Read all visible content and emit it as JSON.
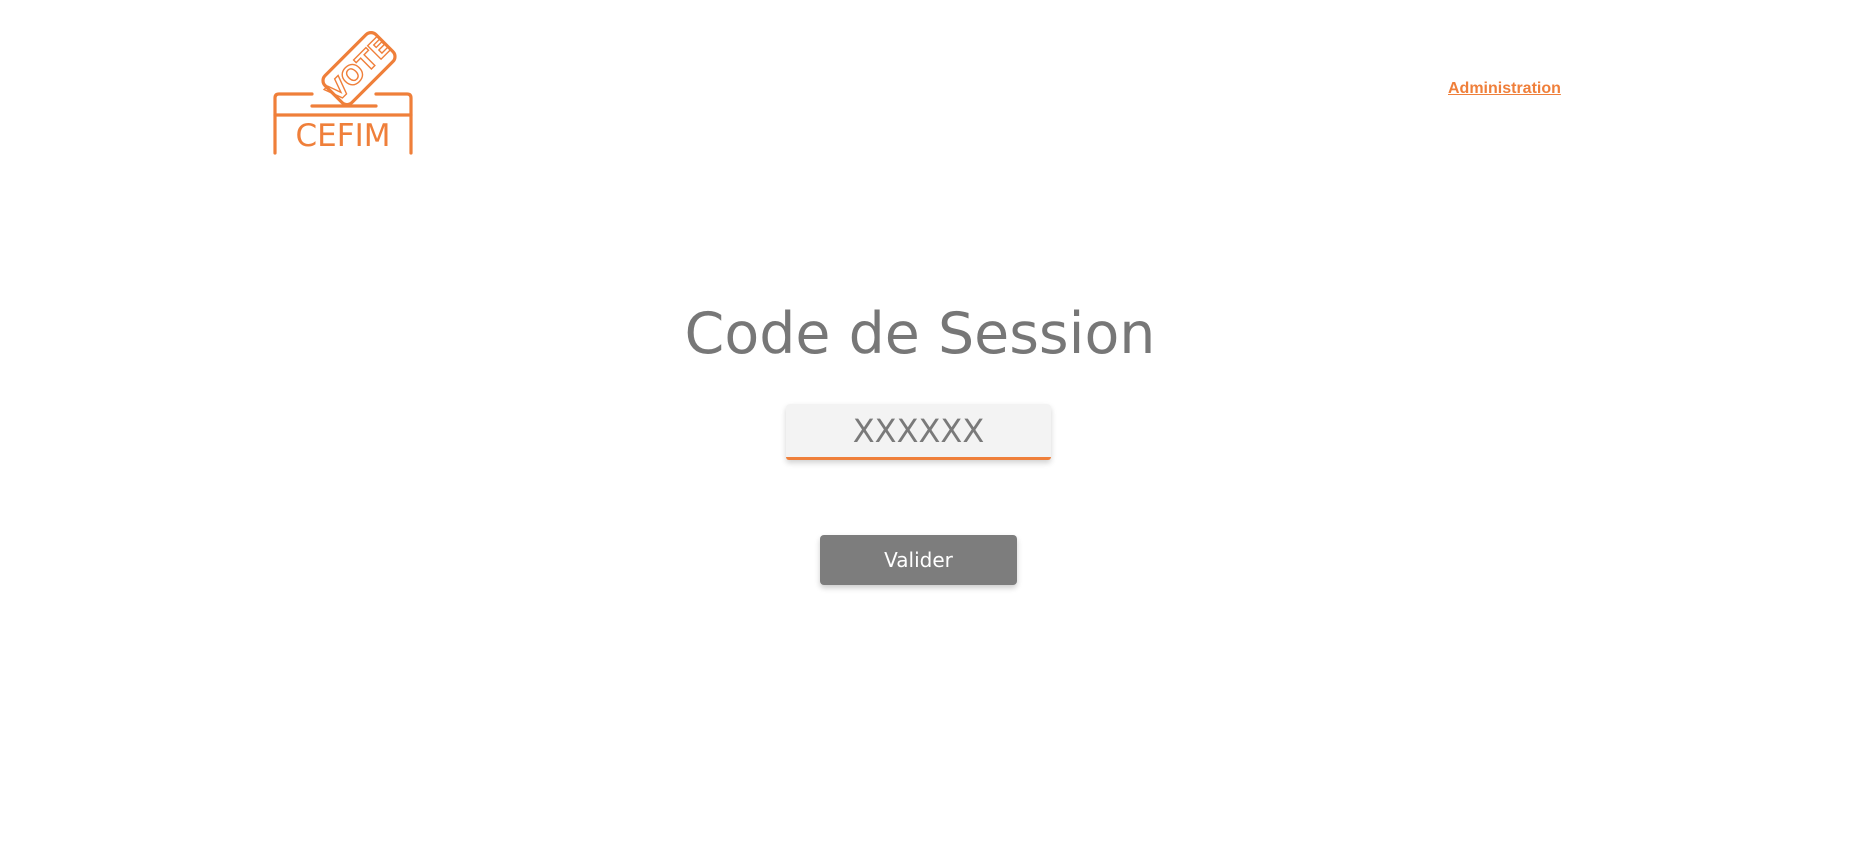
{
  "header": {
    "logo": {
      "icon": "ballot-box-icon",
      "ballot_text": "VOTE",
      "box_text": "CEFIM",
      "color": "#ef7f3a"
    },
    "admin_link": "Administration"
  },
  "main": {
    "title": "Code de Session",
    "code_input": {
      "value": "",
      "placeholder": "XXXXXX"
    },
    "submit_label": "Valider"
  },
  "colors": {
    "accent": "#ef7f3a",
    "text_gray": "#777777",
    "button_bg": "#7d7d7d",
    "input_bg": "#f3f3f3"
  }
}
